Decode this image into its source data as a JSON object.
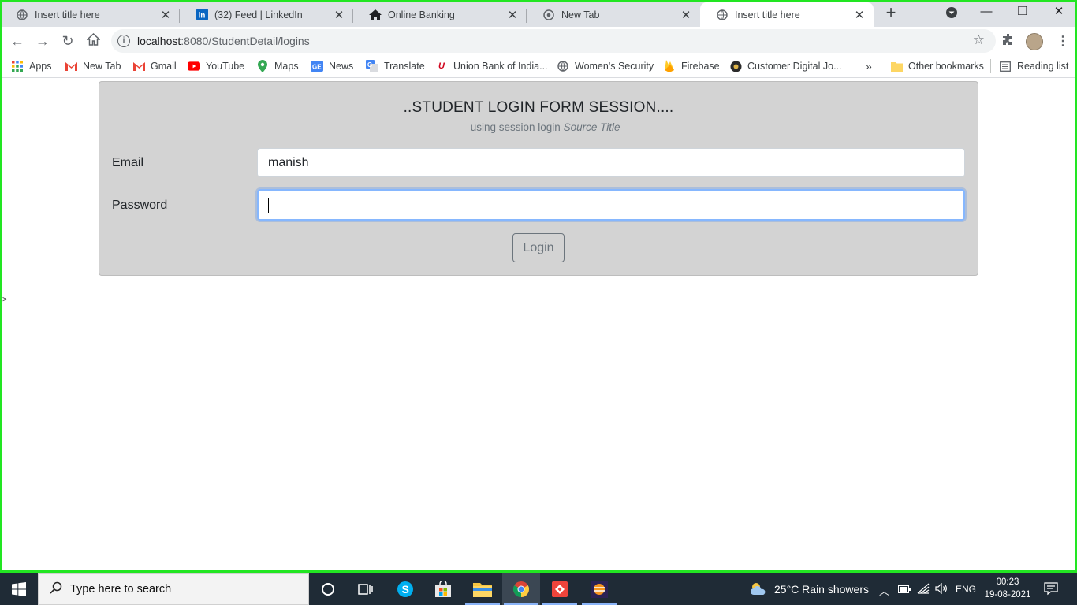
{
  "browser": {
    "tabs": [
      {
        "title": "Insert title here",
        "icon": "globe-icon"
      },
      {
        "title": "(32) Feed | LinkedIn",
        "icon": "linkedin-icon"
      },
      {
        "title": "Online Banking",
        "icon": "home-icon"
      },
      {
        "title": "New Tab",
        "icon": "chrome-icon"
      },
      {
        "title": "Insert title here",
        "icon": "globe-icon",
        "active": true
      }
    ],
    "url_host": "localhost",
    "url_path": ":8080/StudentDetail/logins",
    "bookmarks": [
      {
        "label": "Apps",
        "icon": "apps-grid-icon"
      },
      {
        "label": "New Tab",
        "icon": "gmail-icon"
      },
      {
        "label": "Gmail",
        "icon": "gmail-icon"
      },
      {
        "label": "YouTube",
        "icon": "youtube-icon"
      },
      {
        "label": "Maps",
        "icon": "maps-icon"
      },
      {
        "label": "News",
        "icon": "news-icon"
      },
      {
        "label": "Translate",
        "icon": "translate-icon"
      },
      {
        "label": "Union Bank of India...",
        "icon": "union-bank-icon"
      },
      {
        "label": "Women's Security",
        "icon": "globe-icon"
      },
      {
        "label": "Firebase",
        "icon": "firebase-icon"
      },
      {
        "label": "Customer Digital Jo...",
        "icon": "customer-icon"
      }
    ],
    "overflow": "»",
    "other_bookmarks": "Other bookmarks",
    "reading_list": "Reading list"
  },
  "form": {
    "title": "..STUDENT LOGIN FORM SESSION....",
    "subtitle_prefix": "—  using session login",
    "subtitle_italic": "Source Title",
    "email_label": "Email",
    "email_value": "manish",
    "password_label": "Password",
    "password_value": "",
    "login_label": "Login"
  },
  "taskbar": {
    "search_placeholder": "Type here to search",
    "weather": "25°C  Rain showers",
    "lang": "ENG",
    "time": "00:23",
    "date": "19-08-2021"
  },
  "colors": {
    "frame": "#22e622",
    "card": "#d3d3d3",
    "focus_ring": "#86b7fe",
    "taskbar": "#1f2b36"
  }
}
